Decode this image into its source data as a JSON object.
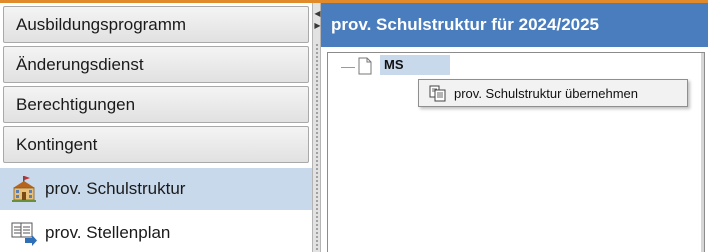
{
  "sidebar": {
    "buttons": [
      {
        "label": "Ausbildungsprogramm"
      },
      {
        "label": "Änderungsdienst"
      },
      {
        "label": "Berechtigungen"
      },
      {
        "label": "Kontingent"
      }
    ],
    "items": [
      {
        "label": "prov. Schulstruktur",
        "icon": "school-building-icon",
        "selected": true
      },
      {
        "label": "prov. Stellenplan",
        "icon": "documents-arrow-icon",
        "selected": false
      }
    ]
  },
  "panel": {
    "title": "prov. Schulstruktur für 2024/2025",
    "tree": {
      "root_label": "MS",
      "root_icon": "document-icon"
    },
    "context_menu": {
      "item_label": "prov. Schulstruktur übernehmen",
      "item_icon": "copy-document-icon"
    }
  },
  "colors": {
    "header_blue": "#4a7dbd",
    "selection_blue": "#c8d9ec",
    "frame_orange": "#e08a2c"
  }
}
